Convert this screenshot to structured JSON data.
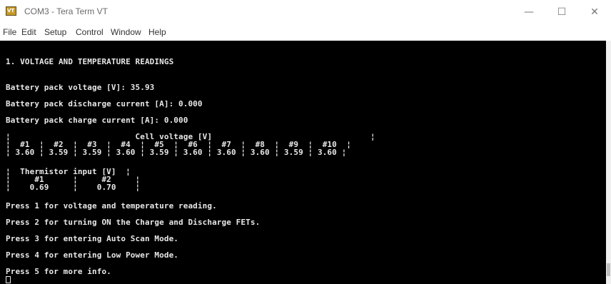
{
  "window": {
    "title": "COM3 - Tera Term VT",
    "icon_name": "tera-term-icon",
    "icon_text": "VT",
    "controls": {
      "minimize": "—",
      "maximize": "☐",
      "close": "✕"
    }
  },
  "menu": [
    "File",
    "Edit",
    "Setup",
    "Control",
    "Window",
    "Help"
  ],
  "terminal": {
    "lines": [
      "1. VOLTAGE AND TEMPERATURE READINGS",
      "Battery pack voltage [V]: 35.93",
      "Battery pack discharge current [A]: 0.000",
      "Battery pack charge current [A]: 0.000",
      "¦                          Cell voltage [V]                                 ¦",
      "¦  #1  ¦  #2  ¦  #3  ¦  #4  ¦  #5  ¦  #6  ¦  #7  ¦  #8  ¦  #9  ¦  #10  ¦",
      "¦ 3.60 ¦ 3.59 ¦ 3.59 ¦ 3.60 ¦ 3.59 ¦ 3.60 ¦ 3.60 ¦ 3.60 ¦ 3.59 ¦ 3.60 ¦",
      "¦  Thermistor input [V]  ¦",
      "¦     #1      ¦     #2     ¦",
      "¦    0.69     ¦    0.70    ¦",
      "Press 1 for voltage and temperature reading.",
      "Press 2 for turning ON the Charge and Discharge FETs.",
      "Press 3 for entering Auto Scan Mode.",
      "Press 4 for entering Low Power Mode.",
      "Press 5 for more info."
    ]
  }
}
